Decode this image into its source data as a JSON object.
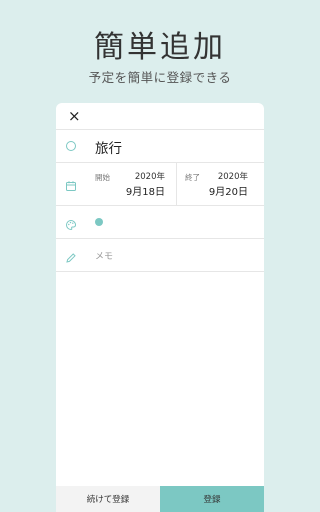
{
  "promo": {
    "headline": "簡単追加",
    "subline": "予定を簡単に登録できる"
  },
  "card": {
    "close_icon": "×",
    "title": "旅行",
    "date": {
      "start_label": "開始",
      "start_year": "2020年",
      "start_day": "9月18日",
      "end_label": "終了",
      "end_year": "2020年",
      "end_day": "9月20日"
    },
    "color": "#7cc8c3",
    "memo_placeholder": "メモ",
    "buttons": {
      "continue_label": "続けて登録",
      "save_label": "登録"
    }
  },
  "colors": {
    "background": "#dceeed",
    "accent": "#7cc8c3"
  }
}
